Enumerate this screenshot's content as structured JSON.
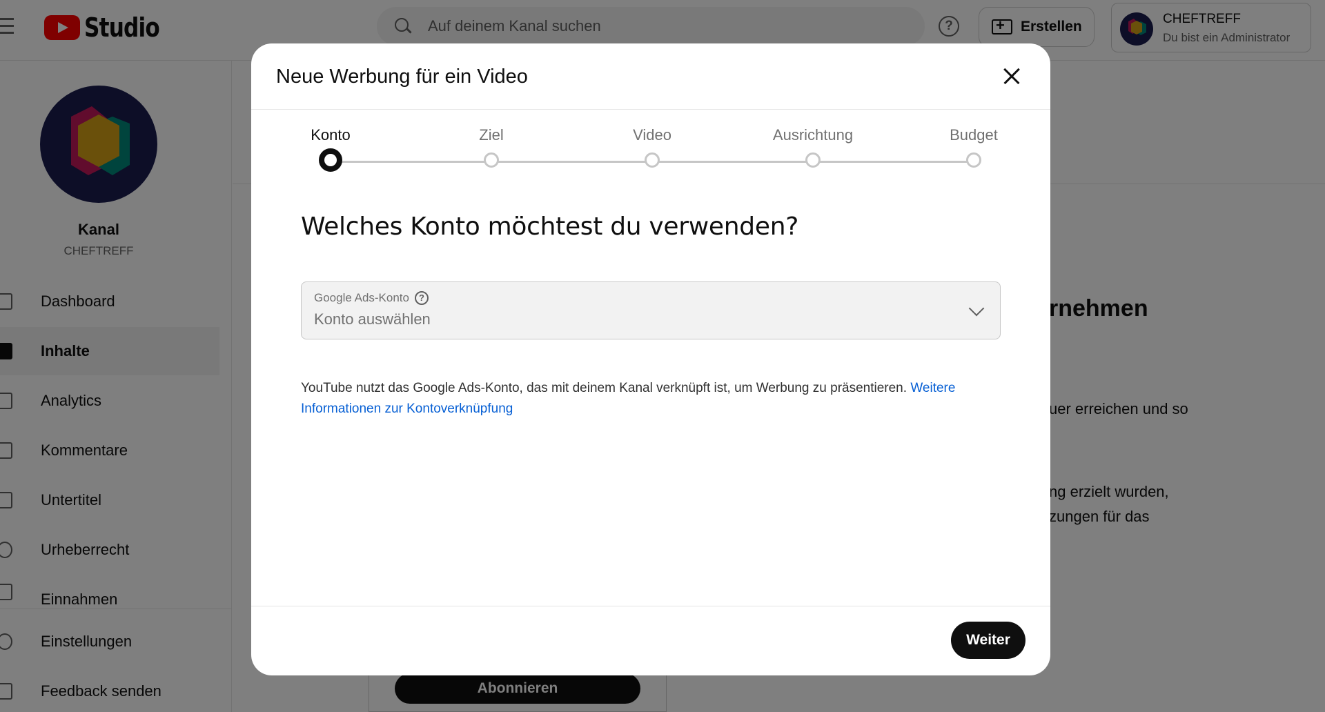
{
  "app": {
    "logo_text": "Studio"
  },
  "header": {
    "search_placeholder": "Auf deinem Kanal suchen",
    "help_glyph": "?",
    "create_label": "Erstellen",
    "account_name": "CHEFTREFF",
    "account_role": "Du bist ein Administrator"
  },
  "sidebar": {
    "channel_label": "Kanal",
    "channel_name": "CHEFTREFF",
    "items": [
      {
        "label": "Dashboard",
        "icon": "dashboard-icon"
      },
      {
        "label": "Inhalte",
        "icon": "content-icon",
        "active": true
      },
      {
        "label": "Analytics",
        "icon": "analytics-icon"
      },
      {
        "label": "Kommentare",
        "icon": "comments-icon"
      },
      {
        "label": "Untertitel",
        "icon": "subtitles-icon"
      },
      {
        "label": "Urheberrecht",
        "icon": "copyright-icon"
      },
      {
        "label": "Einnahmen",
        "icon": "earn-icon"
      },
      {
        "label": "Einstellungen",
        "icon": "settings-icon"
      },
      {
        "label": "Feedback senden",
        "icon": "feedback-icon"
      }
    ]
  },
  "background": {
    "heading_fragment": "rnehmen",
    "text_lines": [
      "uer erreichen und so",
      "ng erzielt wurden,",
      "zungen für das"
    ],
    "subscribe_label": "Abonnieren"
  },
  "modal": {
    "title": "Neue Werbung für ein Video",
    "steps": [
      {
        "label": "Konto",
        "active": true
      },
      {
        "label": "Ziel"
      },
      {
        "label": "Video"
      },
      {
        "label": "Ausrichtung"
      },
      {
        "label": "Budget"
      }
    ],
    "question": "Welches Konto möchtest du verwenden?",
    "select": {
      "label": "Google Ads-Konto",
      "help_glyph": "?",
      "value": "Konto auswählen"
    },
    "info_text": "YouTube nutzt das Google Ads-Konto, das mit deinem Kanal verknüpft ist, um Werbung zu präsentieren. ",
    "info_link": "Weitere Informationen zur Kontoverknüpfung",
    "next_label": "Weiter"
  },
  "colors": {
    "brand_red": "#ff0000",
    "link_blue": "#065fd4",
    "avatar_bg": "#1a1c4e"
  }
}
